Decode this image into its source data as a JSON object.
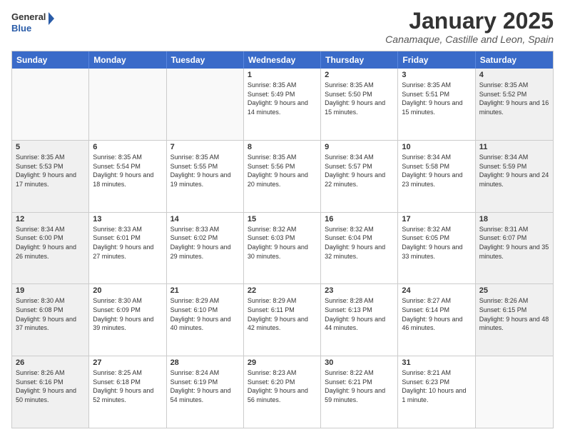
{
  "logo": {
    "line1": "General",
    "line2": "Blue"
  },
  "title": "January 2025",
  "subtitle": "Canamaque, Castille and Leon, Spain",
  "weekdays": [
    "Sunday",
    "Monday",
    "Tuesday",
    "Wednesday",
    "Thursday",
    "Friday",
    "Saturday"
  ],
  "weeks": [
    [
      {
        "day": "",
        "sunrise": "",
        "sunset": "",
        "daylight": "",
        "empty": true
      },
      {
        "day": "",
        "sunrise": "",
        "sunset": "",
        "daylight": "",
        "empty": true
      },
      {
        "day": "",
        "sunrise": "",
        "sunset": "",
        "daylight": "",
        "empty": true
      },
      {
        "day": "1",
        "sunrise": "Sunrise: 8:35 AM",
        "sunset": "Sunset: 5:49 PM",
        "daylight": "Daylight: 9 hours and 14 minutes.",
        "empty": false
      },
      {
        "day": "2",
        "sunrise": "Sunrise: 8:35 AM",
        "sunset": "Sunset: 5:50 PM",
        "daylight": "Daylight: 9 hours and 15 minutes.",
        "empty": false
      },
      {
        "day": "3",
        "sunrise": "Sunrise: 8:35 AM",
        "sunset": "Sunset: 5:51 PM",
        "daylight": "Daylight: 9 hours and 15 minutes.",
        "empty": false
      },
      {
        "day": "4",
        "sunrise": "Sunrise: 8:35 AM",
        "sunset": "Sunset: 5:52 PM",
        "daylight": "Daylight: 9 hours and 16 minutes.",
        "empty": false
      }
    ],
    [
      {
        "day": "5",
        "sunrise": "Sunrise: 8:35 AM",
        "sunset": "Sunset: 5:53 PM",
        "daylight": "Daylight: 9 hours and 17 minutes.",
        "empty": false
      },
      {
        "day": "6",
        "sunrise": "Sunrise: 8:35 AM",
        "sunset": "Sunset: 5:54 PM",
        "daylight": "Daylight: 9 hours and 18 minutes.",
        "empty": false
      },
      {
        "day": "7",
        "sunrise": "Sunrise: 8:35 AM",
        "sunset": "Sunset: 5:55 PM",
        "daylight": "Daylight: 9 hours and 19 minutes.",
        "empty": false
      },
      {
        "day": "8",
        "sunrise": "Sunrise: 8:35 AM",
        "sunset": "Sunset: 5:56 PM",
        "daylight": "Daylight: 9 hours and 20 minutes.",
        "empty": false
      },
      {
        "day": "9",
        "sunrise": "Sunrise: 8:34 AM",
        "sunset": "Sunset: 5:57 PM",
        "daylight": "Daylight: 9 hours and 22 minutes.",
        "empty": false
      },
      {
        "day": "10",
        "sunrise": "Sunrise: 8:34 AM",
        "sunset": "Sunset: 5:58 PM",
        "daylight": "Daylight: 9 hours and 23 minutes.",
        "empty": false
      },
      {
        "day": "11",
        "sunrise": "Sunrise: 8:34 AM",
        "sunset": "Sunset: 5:59 PM",
        "daylight": "Daylight: 9 hours and 24 minutes.",
        "empty": false
      }
    ],
    [
      {
        "day": "12",
        "sunrise": "Sunrise: 8:34 AM",
        "sunset": "Sunset: 6:00 PM",
        "daylight": "Daylight: 9 hours and 26 minutes.",
        "empty": false
      },
      {
        "day": "13",
        "sunrise": "Sunrise: 8:33 AM",
        "sunset": "Sunset: 6:01 PM",
        "daylight": "Daylight: 9 hours and 27 minutes.",
        "empty": false
      },
      {
        "day": "14",
        "sunrise": "Sunrise: 8:33 AM",
        "sunset": "Sunset: 6:02 PM",
        "daylight": "Daylight: 9 hours and 29 minutes.",
        "empty": false
      },
      {
        "day": "15",
        "sunrise": "Sunrise: 8:32 AM",
        "sunset": "Sunset: 6:03 PM",
        "daylight": "Daylight: 9 hours and 30 minutes.",
        "empty": false
      },
      {
        "day": "16",
        "sunrise": "Sunrise: 8:32 AM",
        "sunset": "Sunset: 6:04 PM",
        "daylight": "Daylight: 9 hours and 32 minutes.",
        "empty": false
      },
      {
        "day": "17",
        "sunrise": "Sunrise: 8:32 AM",
        "sunset": "Sunset: 6:05 PM",
        "daylight": "Daylight: 9 hours and 33 minutes.",
        "empty": false
      },
      {
        "day": "18",
        "sunrise": "Sunrise: 8:31 AM",
        "sunset": "Sunset: 6:07 PM",
        "daylight": "Daylight: 9 hours and 35 minutes.",
        "empty": false
      }
    ],
    [
      {
        "day": "19",
        "sunrise": "Sunrise: 8:30 AM",
        "sunset": "Sunset: 6:08 PM",
        "daylight": "Daylight: 9 hours and 37 minutes.",
        "empty": false
      },
      {
        "day": "20",
        "sunrise": "Sunrise: 8:30 AM",
        "sunset": "Sunset: 6:09 PM",
        "daylight": "Daylight: 9 hours and 39 minutes.",
        "empty": false
      },
      {
        "day": "21",
        "sunrise": "Sunrise: 8:29 AM",
        "sunset": "Sunset: 6:10 PM",
        "daylight": "Daylight: 9 hours and 40 minutes.",
        "empty": false
      },
      {
        "day": "22",
        "sunrise": "Sunrise: 8:29 AM",
        "sunset": "Sunset: 6:11 PM",
        "daylight": "Daylight: 9 hours and 42 minutes.",
        "empty": false
      },
      {
        "day": "23",
        "sunrise": "Sunrise: 8:28 AM",
        "sunset": "Sunset: 6:13 PM",
        "daylight": "Daylight: 9 hours and 44 minutes.",
        "empty": false
      },
      {
        "day": "24",
        "sunrise": "Sunrise: 8:27 AM",
        "sunset": "Sunset: 6:14 PM",
        "daylight": "Daylight: 9 hours and 46 minutes.",
        "empty": false
      },
      {
        "day": "25",
        "sunrise": "Sunrise: 8:26 AM",
        "sunset": "Sunset: 6:15 PM",
        "daylight": "Daylight: 9 hours and 48 minutes.",
        "empty": false
      }
    ],
    [
      {
        "day": "26",
        "sunrise": "Sunrise: 8:26 AM",
        "sunset": "Sunset: 6:16 PM",
        "daylight": "Daylight: 9 hours and 50 minutes.",
        "empty": false
      },
      {
        "day": "27",
        "sunrise": "Sunrise: 8:25 AM",
        "sunset": "Sunset: 6:18 PM",
        "daylight": "Daylight: 9 hours and 52 minutes.",
        "empty": false
      },
      {
        "day": "28",
        "sunrise": "Sunrise: 8:24 AM",
        "sunset": "Sunset: 6:19 PM",
        "daylight": "Daylight: 9 hours and 54 minutes.",
        "empty": false
      },
      {
        "day": "29",
        "sunrise": "Sunrise: 8:23 AM",
        "sunset": "Sunset: 6:20 PM",
        "daylight": "Daylight: 9 hours and 56 minutes.",
        "empty": false
      },
      {
        "day": "30",
        "sunrise": "Sunrise: 8:22 AM",
        "sunset": "Sunset: 6:21 PM",
        "daylight": "Daylight: 9 hours and 59 minutes.",
        "empty": false
      },
      {
        "day": "31",
        "sunrise": "Sunrise: 8:21 AM",
        "sunset": "Sunset: 6:23 PM",
        "daylight": "Daylight: 10 hours and 1 minute.",
        "empty": false
      },
      {
        "day": "",
        "sunrise": "",
        "sunset": "",
        "daylight": "",
        "empty": true
      }
    ]
  ]
}
